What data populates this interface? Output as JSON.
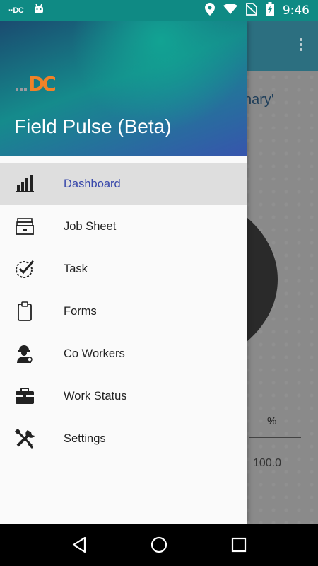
{
  "status_bar": {
    "app_logo_text": "··DC",
    "time": "9:46",
    "icons": [
      "app-logo-icon",
      "android-icon",
      "location-icon",
      "wifi-icon",
      "no-sim-icon",
      "battery-charging-icon"
    ]
  },
  "background": {
    "summary_fragment": "nary'",
    "table_header": "%",
    "table_value": "100.0"
  },
  "drawer": {
    "logo_text": "DC",
    "title": "Field Pulse (Beta)",
    "items": [
      {
        "label": "Dashboard",
        "icon": "bar-chart-icon",
        "active": true
      },
      {
        "label": "Job Sheet",
        "icon": "file-box-icon",
        "active": false
      },
      {
        "label": "Task",
        "icon": "task-check-icon",
        "active": false
      },
      {
        "label": "Forms",
        "icon": "clipboard-icon",
        "active": false
      },
      {
        "label": "Co Workers",
        "icon": "worker-icon",
        "active": false
      },
      {
        "label": "Work Status",
        "icon": "briefcase-icon",
        "active": false
      },
      {
        "label": "Settings",
        "icon": "tools-icon",
        "active": false
      }
    ]
  },
  "colors": {
    "status_bar": "#0f8a84",
    "active_label": "#3949ab",
    "active_row": "#dedede",
    "logo_orange": "#f08228"
  },
  "nav_bar": {
    "buttons": [
      "back-icon",
      "home-icon",
      "recents-icon"
    ]
  }
}
